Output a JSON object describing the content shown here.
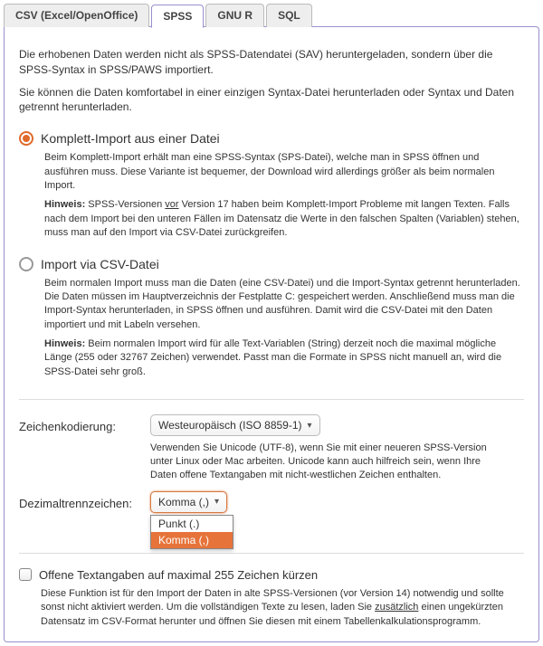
{
  "tabs": {
    "csv": "CSV (Excel/OpenOffice)",
    "spss": "SPSS",
    "gnur": "GNU R",
    "sql": "SQL"
  },
  "intro": {
    "p1": "Die erhobenen Daten werden nicht als SPSS-Datendatei (SAV) heruntergeladen, sondern über die SPSS-Syntax in SPSS/PAWS importiert.",
    "p2": "Sie können die Daten komfortabel in einer einzigen Syntax-Datei herunterladen oder Syntax und Daten getrennt herunterladen."
  },
  "opt1": {
    "label": "Komplett-Import aus einer Datei",
    "desc": "Beim Komplett-Import erhält man eine SPSS-Syntax (SPS-Datei), welche man in SPSS öffnen und ausführen muss. Diese Variante ist bequemer, der Download wird allerdings größer als beim normalen Import.",
    "hint_label": "Hinweis:",
    "hint_a": " SPSS-Versionen ",
    "hint_vor": "vor",
    "hint_b": " Version 17 haben beim Komplett-Import Probleme mit langen Texten. Falls nach dem Import bei den unteren Fällen im Datensatz die Werte in den falschen Spalten (Variablen) stehen, muss man auf den Import via CSV-Datei zurückgreifen."
  },
  "opt2": {
    "label": "Import via CSV-Datei",
    "desc": "Beim normalen Import muss man die Daten (eine CSV-Datei) und die Import-Syntax getrennt herunterladen. Die Daten müssen im Hauptverzeichnis der Festplatte C: gespeichert werden. Anschließend muss man die Import-Syntax herunterladen, in SPSS öffnen und ausführen. Damit wird die CSV-Datei mit den Daten importiert und mit Labeln versehen.",
    "hint_label": "Hinweis:",
    "hint": " Beim normalen Import wird für alle Text-Variablen (String) derzeit noch die maximal mögliche Länge (255 oder 32767 Zeichen) verwendet. Passt man die Formate in SPSS nicht manuell an, wird die SPSS-Datei sehr groß."
  },
  "encoding": {
    "label": "Zeichenkodierung:",
    "value": "Westeuropäisch (ISO 8859-1)",
    "help": "Verwenden Sie Unicode (UTF-8), wenn Sie mit einer neueren SPSS-Version unter Linux oder Mac arbeiten. Unicode kann auch hilfreich sein, wenn Ihre Daten offene Textangaben mit nicht-westlichen Zeichen enthalten."
  },
  "decimal": {
    "label": "Dezimaltrennzeichen:",
    "value": "Komma (,)",
    "options": {
      "punkt": "Punkt (.)",
      "komma": "Komma (,)"
    }
  },
  "truncate": {
    "label": "Offene Textangaben auf maximal 255 Zeichen kürzen",
    "desc_a": "Diese Funktion ist für den Import der Daten in alte SPSS-Versionen (vor Version 14) notwendig und sollte sonst nicht aktiviert werden. Um die vollständigen Texte zu lesen, laden Sie ",
    "desc_zus": "zusätzlich",
    "desc_b": " einen ungekürzten Datensatz im CSV-Format herunter und öffnen Sie diesen mit einem Tabellenkalkulationsprogramm."
  }
}
